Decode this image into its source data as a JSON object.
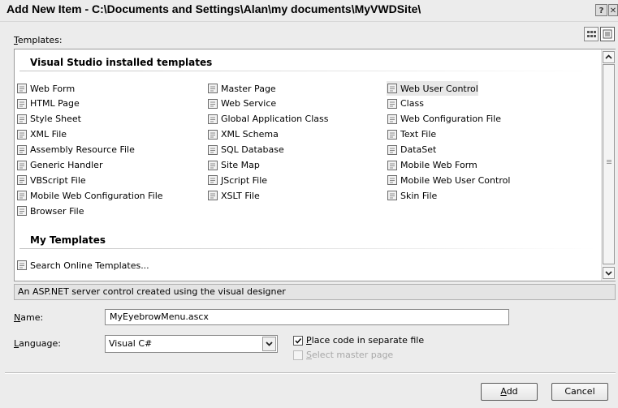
{
  "title": "Add New Item - C:\\Documents and Settings\\Alan\\my documents\\MyVWDSite\\",
  "templates_label": "Templates:",
  "sections": {
    "installed": "Visual Studio installed templates",
    "mine": "My Templates"
  },
  "templates": {
    "col1": [
      "Web Form",
      "HTML Page",
      "Style Sheet",
      "XML File",
      "Assembly Resource File",
      "Generic Handler",
      "VBScript File",
      "Mobile Web Configuration File",
      "Browser File"
    ],
    "col2": [
      "Master Page",
      "Web Service",
      "Global Application Class",
      "XML Schema",
      "SQL Database",
      "Site Map",
      "JScript File",
      "XSLT File"
    ],
    "col3": [
      "Web User Control",
      "Class",
      "Web Configuration File",
      "Text File",
      "DataSet",
      "Mobile Web Form",
      "Mobile Web User Control",
      "Skin File"
    ],
    "my": [
      "Search Online Templates..."
    ]
  },
  "selected_template": "Web User Control",
  "description": "An ASP.NET server control created using the visual designer",
  "form": {
    "name_label": "Name:",
    "name_value": "MyEyebrowMenu.ascx",
    "language_label": "Language:",
    "language_value": "Visual C#",
    "place_code_label": "Place code in separate file",
    "place_code_checked": true,
    "master_page_label": "Select master page",
    "master_page_checked": false
  },
  "buttons": {
    "add": "Add",
    "cancel": "Cancel"
  }
}
